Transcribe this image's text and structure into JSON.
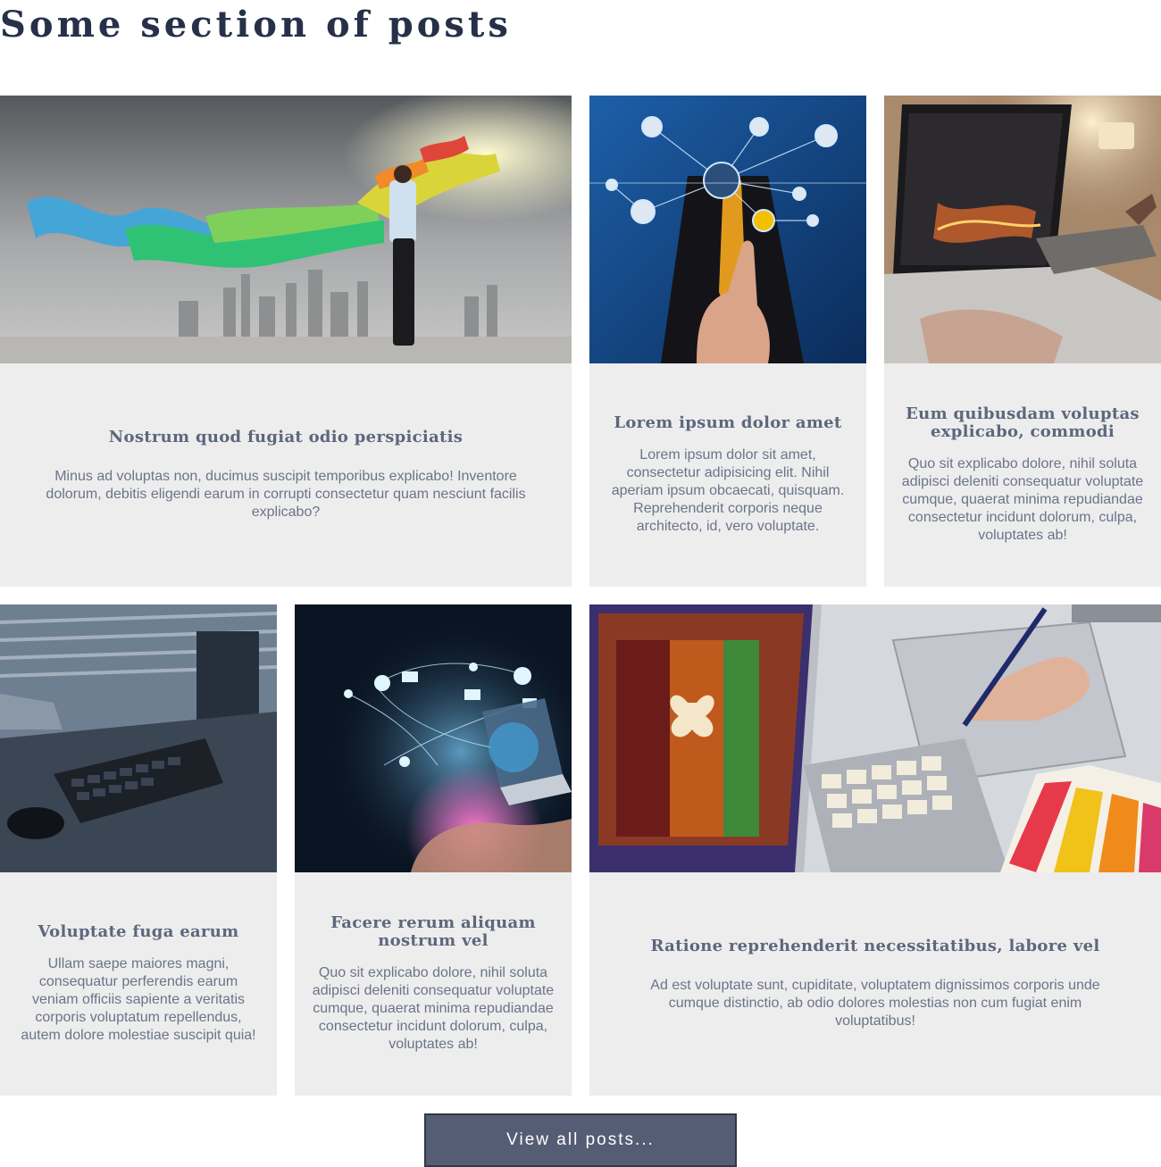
{
  "section": {
    "title": "Some section of posts"
  },
  "posts": [
    {
      "title": "Nostrum quod fugiat odio perspiciatis",
      "text": "Minus ad voluptas non, ducimus suscipit temporibus explicabo! Inventore dolorum, debitis eligendi earum in corrupti consectetur quam nesciunt facilis explicabo?",
      "image": "paint-splash-city-image"
    },
    {
      "title": "Lorem ipsum dolor amet",
      "text": "Lorem ipsum dolor sit amet, consectetur adipisicing elit. Nihil aperiam ipsum obcaecati, quisquam. Reprehenderit corporis neque architecto, id, vero voluptate.",
      "image": "social-network-touch-image"
    },
    {
      "title": "Eum quibusdam voluptas explicabo, commodi",
      "text": "Quo sit explicabo dolore, nihil soluta adipisci deleniti consequatur voluptate cumque, quaerat minima repudiandae consectetur incidunt dolorum, culpa, voluptates ab!",
      "image": "laptop-tablet-image"
    },
    {
      "title": "Voluptate fuga earum",
      "text": "Ullam saepe maiores magni, consequatur perferendis earum veniam officiis sapiente a veritatis corporis voluptatum repellendus, autem dolore molestiae suscipit quia!",
      "image": "keyboard-office-image"
    },
    {
      "title": "Facere rerum aliquam nostrum vel",
      "text": "Quo sit explicabo dolore, nihil soluta adipisci deleniti consequatur voluptate cumque, quaerat minima repudiandae consectetur incidunt dolorum, culpa, voluptates ab!",
      "image": "laptop-hand-network-image"
    },
    {
      "title": "Ratione reprehenderit necessitatibus, labore vel",
      "text": "Ad est voluptate sunt, cupiditate, voluptatem dignissimos corporis unde cumque distinctio, ab odio dolores molestias non cum fugiat enim voluptatibus!",
      "image": "designer-drawing-tablet-image"
    }
  ],
  "actions": {
    "view_all_label": "View all posts..."
  },
  "colors": {
    "title": "#263048",
    "card_bg": "#ededee",
    "card_heading": "#5d677c",
    "card_text": "#6b7487",
    "button_bg": "#545d74",
    "button_border": "#30374a"
  }
}
